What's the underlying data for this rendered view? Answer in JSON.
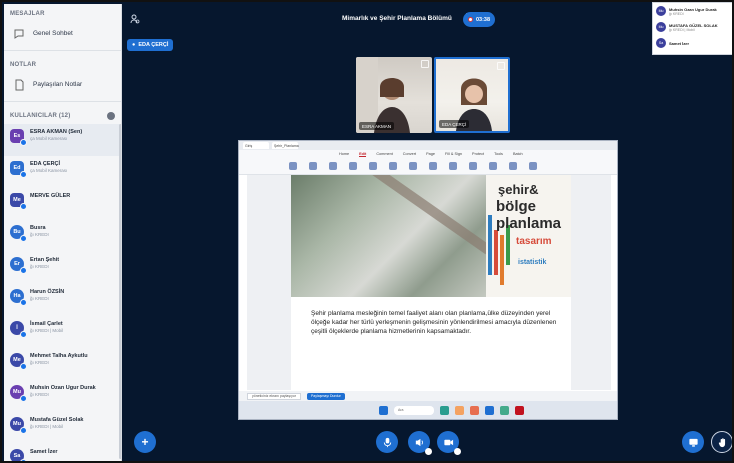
{
  "sidebar": {
    "messages_title": "MESAJLAR",
    "public_chat": "Genel Sohbet",
    "notes_title": "NOTLAR",
    "shared_notes": "Paylaşılan Notlar",
    "users_title": "KULLANICILAR (12)",
    "users": [
      {
        "initials": "Es",
        "name": "ESRA AKMAN (Sen)",
        "sub": "ça Mobil Kamerası",
        "color": "#6a3fb0",
        "round": false
      },
      {
        "initials": "Ed",
        "name": "EDA ÇERÇİ",
        "sub": "ça Mobil Kamerası",
        "color": "#2d6fd0",
        "round": false
      },
      {
        "initials": "Me",
        "name": "MERVE GÜLER",
        "sub": "",
        "color": "#3b49a8",
        "round": false
      },
      {
        "initials": "Bu",
        "name": "Busra",
        "sub": "ğı KREDI",
        "color": "#2d6fd0",
        "round": true
      },
      {
        "initials": "Er",
        "name": "Ertan Şehit",
        "sub": "ğı KREDI",
        "color": "#2d6fd0",
        "round": true
      },
      {
        "initials": "Ha",
        "name": "Harun ÖZSİN",
        "sub": "ğı KREDI",
        "color": "#2d6fd0",
        "round": true
      },
      {
        "initials": "İ",
        "name": "İsmail Çarlet",
        "sub": "ğı KREDI | Mobil",
        "color": "#3b49a8",
        "round": true
      },
      {
        "initials": "Me",
        "name": "Mehmet Talha Aykutlu",
        "sub": "ğı KREDI",
        "color": "#3b49a8",
        "round": true
      },
      {
        "initials": "Mu",
        "name": "Muhsin Ozan Ugur Durak",
        "sub": "ğı KREDI",
        "color": "#6a3fb0",
        "round": true
      },
      {
        "initials": "Mu",
        "name": "Mustafa Güzel Solak",
        "sub": "ğı KREDI | Mobil",
        "color": "#3b49a8",
        "round": true
      },
      {
        "initials": "Sa",
        "name": "Samet İzer",
        "sub": "",
        "color": "#3b49a8",
        "round": true
      }
    ]
  },
  "topbar": {
    "room_title": "Mimarlık ve Şehir Planlama Bölümü",
    "record_label": "03:38",
    "presenter": "EDA ÇERÇİ"
  },
  "notifications": [
    {
      "initials": "Mu",
      "name": "Muhsin Ozan Ugur Durak",
      "sub": "ğı KREDI"
    },
    {
      "initials": "Mu",
      "name": "MUSTAFA GÜZEL SOLAK",
      "sub": "ğı KREDI | Mobil"
    },
    {
      "initials": "Sa",
      "name": "Samet İzer",
      "sub": ""
    }
  ],
  "cams": [
    {
      "label": "ESRA AKMAN"
    },
    {
      "label": "EDA ÇERÇİ"
    }
  ],
  "screen": {
    "tabs": [
      "Giriş",
      "Şehir_Planlama"
    ],
    "menu": [
      "Home",
      "Edit",
      "Comment",
      "Convert",
      "Page",
      "Fill & Sign",
      "Protect",
      "Tools",
      "Batch"
    ],
    "active_menu": "Edit",
    "word_cloud": [
      "şehir&",
      "bölge",
      "planlama",
      "tasarım",
      "istatistik"
    ],
    "doc_text": "Şehir planlama mesleğinin temel faaliyet alanı olan planlama,ülke düzeyinden yerel ölçeğe kadar her türlü yerleşmenin gelişmesinin yönlendirilmesi amacıyla düzenlenen çeşitli ölçeklerde planlama hizmetlerinin kapsamaktadır.",
    "share_text": "yöneticiniz ekranı paylaşıyor",
    "stop_share": "Paylaşmayı Durdur",
    "search": "Ara"
  },
  "colors": {
    "background": "#06172e",
    "accent": "#1f6fd1"
  }
}
